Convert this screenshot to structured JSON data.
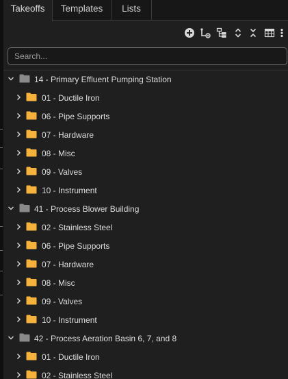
{
  "tabs": [
    {
      "label": "Takeoffs",
      "active": true
    },
    {
      "label": "Templates",
      "active": false
    },
    {
      "label": "Lists",
      "active": false
    }
  ],
  "toolbar": {
    "icons": [
      "add-circle-icon",
      "add-node-icon",
      "tree-hierarchy-icon",
      "expand-all-icon",
      "collapse-all-icon",
      "table-columns-icon",
      "more-vertical-icon"
    ]
  },
  "search": {
    "placeholder": "Search...",
    "value": ""
  },
  "colors": {
    "folder_parent": "#8a8a8a",
    "folder_child": "#f5b23c",
    "background": "#1f1f1f"
  },
  "tree": [
    {
      "label": "14 - Primary Effluent Pumping Station",
      "expanded": true,
      "children": [
        {
          "label": "01 - Ductile Iron"
        },
        {
          "label": "06 - Pipe Supports"
        },
        {
          "label": "07 - Hardware"
        },
        {
          "label": "08 - Misc"
        },
        {
          "label": "09 - Valves"
        },
        {
          "label": "10 - Instrument"
        }
      ]
    },
    {
      "label": "41 - Process Blower Building",
      "expanded": true,
      "children": [
        {
          "label": "02 - Stainless Steel"
        },
        {
          "label": "06 - Pipe Supports"
        },
        {
          "label": "07 - Hardware"
        },
        {
          "label": "08 - Misc"
        },
        {
          "label": "09 - Valves"
        },
        {
          "label": "10 - Instrument"
        }
      ]
    },
    {
      "label": "42 - Process Aeration Basin 6, 7, and 8",
      "expanded": true,
      "children": [
        {
          "label": "01 - Ductile Iron"
        },
        {
          "label": "02 - Stainless Steel"
        }
      ]
    }
  ]
}
